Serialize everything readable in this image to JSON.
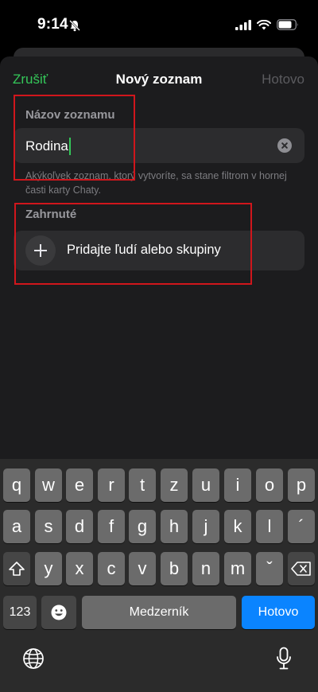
{
  "status_bar": {
    "time": "9:14"
  },
  "nav": {
    "cancel": "Zrušiť",
    "title": "Nový zoznam",
    "done": "Hotovo"
  },
  "name_section": {
    "label": "Názov zoznamu",
    "value": "Rodina",
    "hint": "Akýkoľvek zoznam, ktorý vytvoríte, sa stane filtrom v hornej časti karty Chaty."
  },
  "included_section": {
    "label": "Zahrnuté",
    "add_label": "Pridajte ľudí alebo skupiny"
  },
  "keyboard": {
    "row1": [
      "q",
      "w",
      "e",
      "r",
      "t",
      "z",
      "u",
      "i",
      "o",
      "p"
    ],
    "row2": [
      "a",
      "s",
      "d",
      "f",
      "g",
      "h",
      "j",
      "k",
      "l",
      "´"
    ],
    "row3": [
      "y",
      "x",
      "c",
      "v",
      "b",
      "n",
      "m",
      "ˇ"
    ],
    "numbers_key": "123",
    "space_key": "Medzerník",
    "return_key": "Hotovo"
  },
  "colors": {
    "accent": "#34c759",
    "highlight": "#d0161c",
    "keyboard_action": "#0a84ff"
  }
}
